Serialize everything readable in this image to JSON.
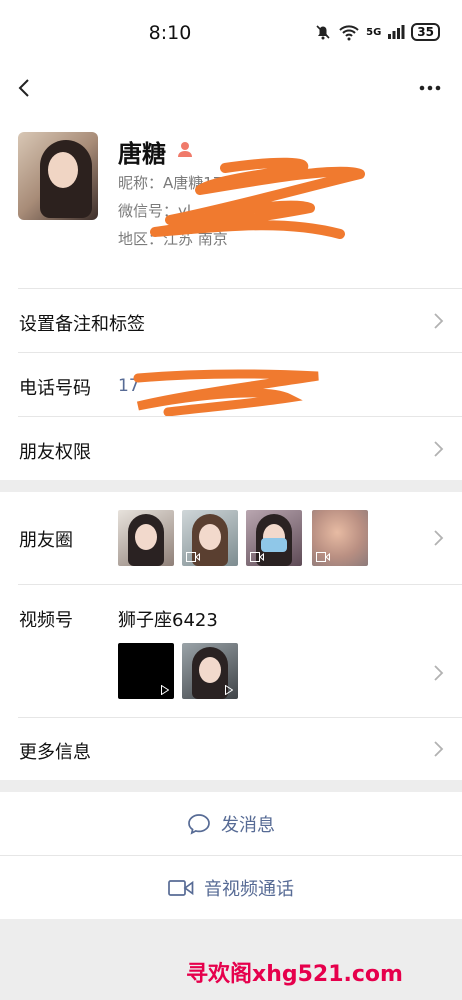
{
  "status": {
    "time": "8:10",
    "battery": "35",
    "network": "5G"
  },
  "nav": {
    "back_icon": "chevron-left-icon",
    "more_icon": "more-dots-icon"
  },
  "profile": {
    "name": "唐糖",
    "nickname": "昵称：A唐糖175",
    "wechat_id": "微信号：yl",
    "region": "地区：江苏  南京"
  },
  "rows": {
    "remark": "设置备注和标签",
    "phone_label": "电话号码",
    "phone_value": "17",
    "permission": "朋友权限",
    "moments": "朋友圈",
    "channels": "视频号",
    "channels_name": "狮子座6423",
    "more_info": "更多信息"
  },
  "actions": {
    "message": "发消息",
    "call": "音视频通话"
  },
  "watermark": "寻欢阁xhg521.com",
  "colors": {
    "link": "#576b95",
    "scribble": "#f07a2f",
    "watermark": "#e6004c"
  }
}
